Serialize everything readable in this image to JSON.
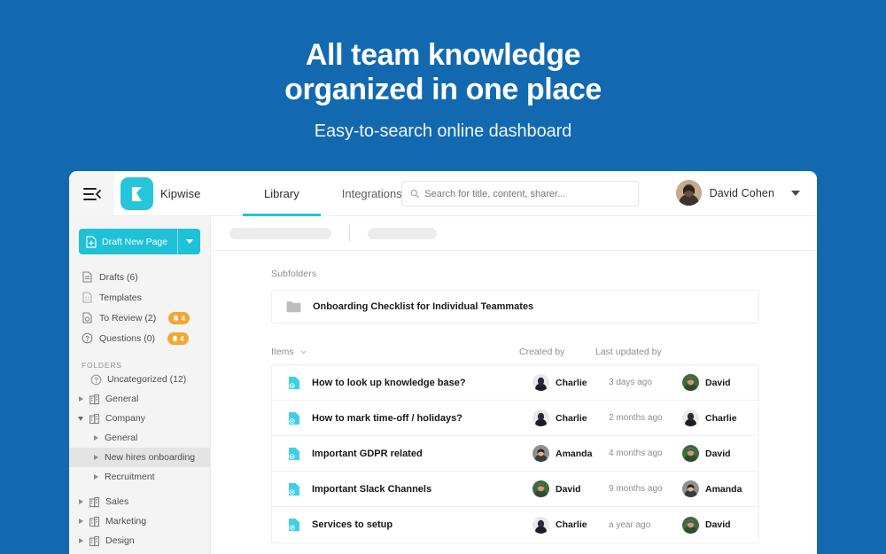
{
  "hero": {
    "title_line1": "All team knowledge",
    "title_line2": "organized in one place",
    "subtitle": "Easy-to-search online dashboard"
  },
  "colors": {
    "page_background": "#1269b0",
    "brand_cyan": "#1fc1d6",
    "tab_underline": "#23c2dc",
    "badge_orange": "#f7a531",
    "sidebar_background": "#f4f4f4",
    "sidebar_selected": "#e4e4e4"
  },
  "topbar": {
    "menu_icon": "hamburger-collapse-icon",
    "logo_icon": "kipwise-logo-icon",
    "brand": "Kipwise",
    "tabs": [
      {
        "label": "Library",
        "active": true
      },
      {
        "label": "Integrations",
        "active": false
      }
    ],
    "search": {
      "icon": "search-icon",
      "placeholder": "Search for title, content, sharer...",
      "value": ""
    },
    "user": {
      "name": "David Cohen",
      "avatar": "user-avatar",
      "caret": "chevron-down-icon"
    }
  },
  "sidebar": {
    "draft_button": {
      "label": "Draft New Page",
      "icon": "new-page-icon",
      "dropdown_icon": "chevron-down-icon"
    },
    "nav": [
      {
        "label": "Drafts (6)",
        "icon": "document-icon",
        "badge": null
      },
      {
        "label": "Templates",
        "icon": "template-icon",
        "badge": null
      },
      {
        "label": "To Review (2)",
        "icon": "review-icon",
        "badge": "4"
      },
      {
        "label": "Questions (0)",
        "icon": "question-icon",
        "badge": "4"
      }
    ],
    "folders_header": "FOLDERS",
    "folders": [
      {
        "label": "Uncategorized (12)",
        "icon": "question-circle-icon",
        "arrow": "none",
        "indent": 0,
        "selected": false
      },
      {
        "label": "General",
        "icon": "building-icon",
        "arrow": "right",
        "indent": 0,
        "selected": false
      },
      {
        "label": "Company",
        "icon": "building-icon",
        "arrow": "down",
        "indent": 0,
        "selected": false
      },
      {
        "label": "General",
        "icon": "none",
        "arrow": "right",
        "indent": 1,
        "selected": false
      },
      {
        "label": "New hires onboarding",
        "icon": "none",
        "arrow": "right",
        "indent": 1,
        "selected": true
      },
      {
        "label": "Recruitment",
        "icon": "none",
        "arrow": "right",
        "indent": 1,
        "selected": false
      },
      {
        "label": "Sales",
        "icon": "building-icon",
        "arrow": "right",
        "indent": 0,
        "selected": false
      },
      {
        "label": "Marketing",
        "icon": "building-icon",
        "arrow": "right",
        "indent": 0,
        "selected": false
      },
      {
        "label": "Design",
        "icon": "building-icon",
        "arrow": "right",
        "indent": 0,
        "selected": false
      }
    ]
  },
  "main": {
    "breadcrumb": {
      "placeholder_a": "",
      "placeholder_b": ""
    },
    "subfolders_label": "Subfolders",
    "subfolders": [
      {
        "name": "Onboarding Checklist for Individual Teammates",
        "icon": "folder-icon"
      }
    ],
    "table": {
      "columns": {
        "items": "Items",
        "sort_icon": "chevron-down-icon",
        "created_by": "Created by",
        "last_updated_by": "Last updated by"
      },
      "rows": [
        {
          "icon": "verified-document-icon",
          "title": "How to look up knowledge base?",
          "created_by": "Charlie",
          "updated_when": "3 days ago",
          "updated_by": "David"
        },
        {
          "icon": "verified-document-icon",
          "title": "How to mark time-off / holidays?",
          "created_by": "Charlie",
          "updated_when": "2 months ago",
          "updated_by": "Charlie"
        },
        {
          "icon": "verified-document-icon",
          "title": "Important GDPR related",
          "created_by": "Amanda",
          "updated_when": "4 months ago",
          "updated_by": "David"
        },
        {
          "icon": "verified-document-icon",
          "title": "Important Slack Channels",
          "created_by": "David",
          "updated_when": "9 months ago",
          "updated_by": "Amanda"
        },
        {
          "icon": "verified-document-icon",
          "title": "Services to setup",
          "created_by": "Charlie",
          "updated_when": "a year ago",
          "updated_by": "David"
        }
      ]
    }
  }
}
